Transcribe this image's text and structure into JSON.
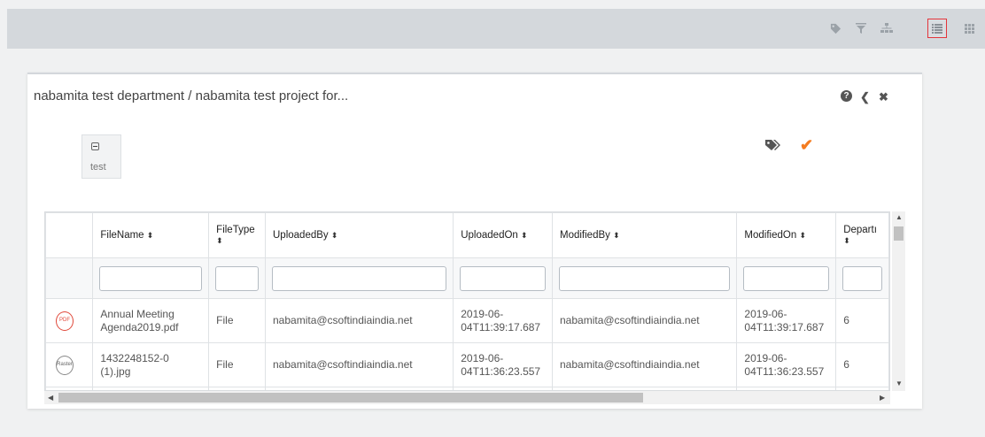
{
  "toolbar": {
    "icons": [
      "tag-icon",
      "filter-icon",
      "sitemap-icon",
      "list-view-icon",
      "grid-view-icon"
    ]
  },
  "panel": {
    "title": "nabamita test department / nabamita test project for...",
    "help_glyph": "?",
    "back_glyph": "❮",
    "close_glyph": "✖",
    "tag_chip_label": "test",
    "tags_glyph": "🏷",
    "check_glyph": "✔"
  },
  "grid": {
    "columns": [
      "",
      "FileName",
      "FileType",
      "UploadedBy",
      "UploadedOn",
      "ModifiedBy",
      "ModifiedOn",
      "Departı"
    ],
    "sort_glyph": "⬍",
    "rows": [
      {
        "icon": "PDF",
        "filename": "Annual Meeting Agenda2019.pdf",
        "filetype": "File",
        "uploadedby": "nabamita@csoftindiaindia.net",
        "uploadedon": "2019-06-04T11:39:17.687",
        "modifiedby": "nabamita@csoftindiaindia.net",
        "modifiedon": "2019-06-04T11:39:17.687",
        "department": "6"
      },
      {
        "icon": "Raster",
        "filename": "1432248152-0 (1).jpg",
        "filetype": "File",
        "uploadedby": "nabamita@csoftindiaindia.net",
        "uploadedon": "2019-06-04T11:36:23.557",
        "modifiedby": "nabamita@csoftindiaindia.net",
        "modifiedon": "2019-06-04T11:36:23.557",
        "department": "6"
      }
    ]
  },
  "colors": {
    "accent_check": "#f47c20",
    "active_border": "#e3353b",
    "pdf_icon": "#e0483a"
  }
}
